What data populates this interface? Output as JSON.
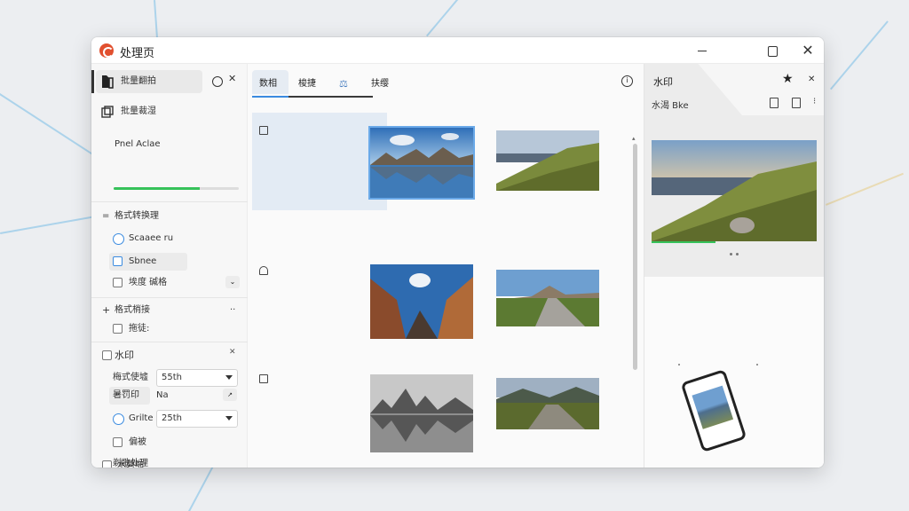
{
  "window": {
    "title": "处理页"
  },
  "sidebar": {
    "items": [
      {
        "label": "批量翻拍",
        "icon": "book-icon"
      },
      {
        "label": "批量裁湿",
        "icon": "copy-icon"
      }
    ],
    "panel_label": "Pnel Aclae",
    "progress": 0.69,
    "section_format": "格式转换理",
    "option_1": "Scaaee ru",
    "option_2": "Sbnee",
    "option_3": "埃度 碱格",
    "section_format2": "格式梢接",
    "option_4": "拖徒:",
    "section_watermark": "水印",
    "format_label": "梅式使墟",
    "format_value": "55th",
    "quality_label": "暑罚印",
    "quality_value": "Na",
    "grille_label": "Grilte",
    "grille_value": "25th",
    "option_5": "偏被",
    "section_watermark2": "水磐啪",
    "bottom_label": "剃歌处理"
  },
  "center": {
    "tabs": [
      "数相",
      "梭捷",
      "扶缨"
    ],
    "active_tab": 0
  },
  "right": {
    "title": "水印",
    "subtitle": "水渴 Bke"
  },
  "colors": {
    "accent": "#3a8be0",
    "progress": "#36c25a",
    "logo": "#e1502f"
  }
}
